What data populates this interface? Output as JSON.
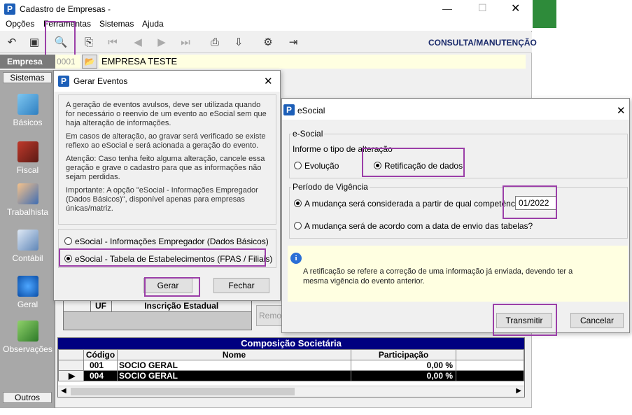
{
  "main_window": {
    "title": "Cadastro de Empresas -",
    "menu": [
      "Opções",
      "Ferramentas",
      "Sistemas",
      "Ajuda"
    ],
    "mode_label": "CONSULTA/MANUTENÇÃO",
    "empresa_label": "Empresa",
    "empresa_code": "0001",
    "empresa_name": "EMPRESA TESTE"
  },
  "sidebar": {
    "top_button": "Sistemas",
    "items": [
      {
        "label": "Básicos",
        "icon": "book-icon"
      },
      {
        "label": "Fiscal",
        "icon": "ledger-icon"
      },
      {
        "label": "Trabalhista",
        "icon": "worker-icon"
      },
      {
        "label": "Contábil",
        "icon": "calculator-icon"
      },
      {
        "label": "Geral",
        "icon": "computer-info-icon"
      },
      {
        "label": "Observações",
        "icon": "notepad-pencil-icon"
      }
    ],
    "bottom_button": "Outros"
  },
  "gerar_dialog": {
    "title": "Gerar Eventos",
    "para1": "A geração de eventos avulsos, deve ser utilizada quando for necessário o reenvio de um evento ao eSocial sem que haja alteração de informações.",
    "para2": "Em casos de alteração, ao gravar será verificado se existe reflexo ao eSocial e será acionada a geração do evento.",
    "para3": "Atenção: Caso tenha feito alguma alteração, cancele essa geração e grave o cadastro para que as informações não sejam perdidas.",
    "para4": "Importante: A opção \"eSocial - Informações Empregador (Dados Básicos)\", disponível apenas para empresas únicas/matriz.",
    "option1": "eSocial - Informações Empregador (Dados Básicos)",
    "option2": "eSocial - Tabela de Estabelecimentos (FPAS / Filiais)",
    "gerar": "Gerar",
    "fechar": "Fechar"
  },
  "ie_table": {
    "col1": "UF",
    "col2": "Inscrição Estadual",
    "remove_button": "Remo"
  },
  "composicao": {
    "title": "Composição Societária",
    "headers": [
      "Código",
      "Nome",
      "Participação"
    ],
    "rows": [
      {
        "codigo": "001",
        "nome": "SOCIO GERAL",
        "participacao": "0,00 %"
      },
      {
        "codigo": "004",
        "nome": "SOCIO GERAL",
        "participacao": "0,00 %"
      }
    ]
  },
  "esocial_dialog": {
    "title": "eSocial",
    "group1_label": "e-Social",
    "prompt": "Informe o tipo de alteração",
    "opt_evolucao": "Evolução",
    "opt_retificacao": "Retificação de dados",
    "group2_label": "Período de Vigência",
    "opt_competencia": "A mudança será considerada a partir de qual competência?",
    "competencia_value": "01/2022",
    "opt_data_envio": "A mudança será de acordo com a data de envio das tabelas?",
    "info_text": "A retificação se refere a correção de uma informação já enviada, devendo ter a mesma vigência do evento anterior.",
    "transmitir": "Transmitir",
    "cancelar": "Cancelar"
  },
  "colors": {
    "highlight": "#9b3fa8",
    "empresa_bar": "#7a7a7a",
    "yellow_field": "#ffffe1",
    "grid_header": "#000080"
  }
}
